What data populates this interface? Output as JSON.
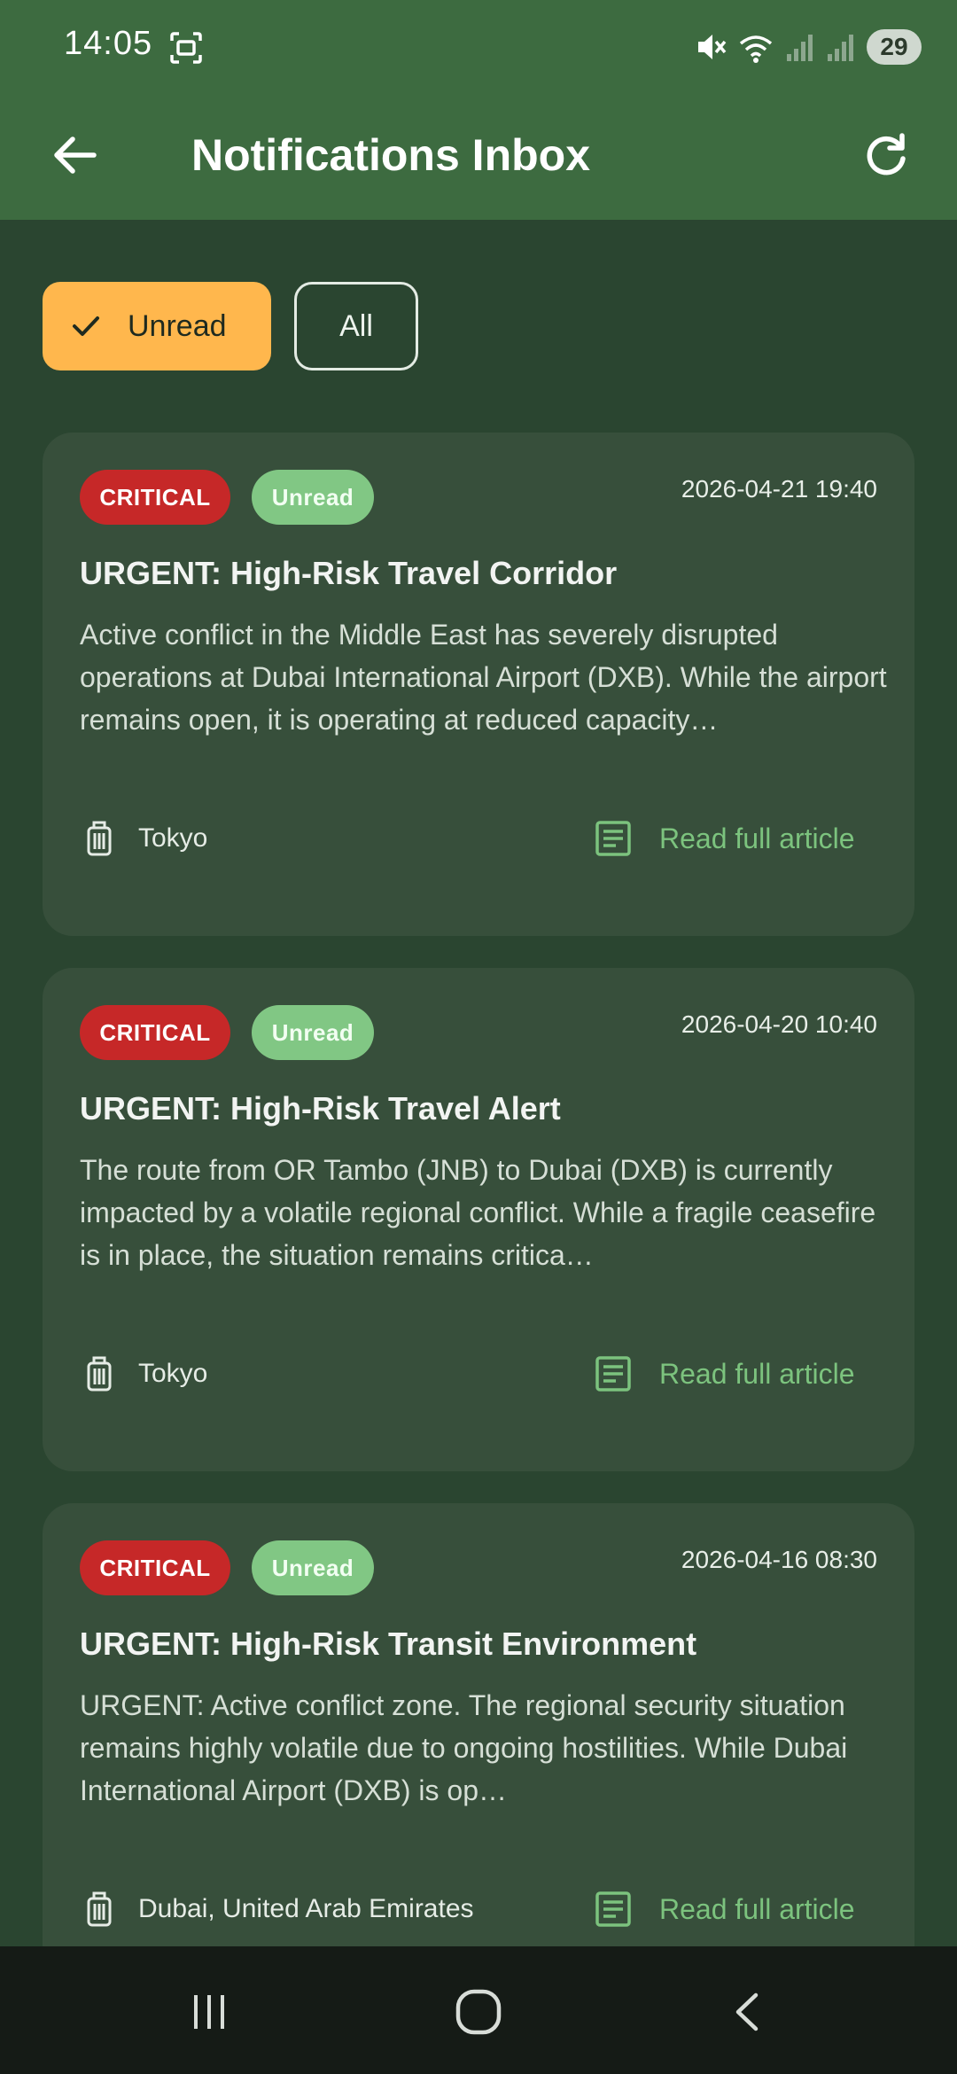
{
  "status_bar": {
    "time": "14:05",
    "battery": "29"
  },
  "header": {
    "title": "Notifications Inbox"
  },
  "filters": {
    "unread_label": "Unread",
    "all_label": "All"
  },
  "notifications": [
    {
      "severity": "CRITICAL",
      "status": "Unread",
      "date": "2026-04-21 19:40",
      "title": "URGENT: High-Risk Travel Corridor",
      "body": "Active conflict in the Middle East has severely disrupted operations at Dubai International Airport (DXB). While the airport remains open, it is operating at reduced capacity…",
      "location": "Tokyo",
      "link_label": "Read full article"
    },
    {
      "severity": "CRITICAL",
      "status": "Unread",
      "date": "2026-04-20 10:40",
      "title": "URGENT: High-Risk Travel Alert",
      "body": "The route from OR Tambo (JNB) to Dubai (DXB) is currently impacted by a volatile regional conflict. While a fragile ceasefire is in place, the situation remains critica…",
      "location": "Tokyo",
      "link_label": "Read full article"
    },
    {
      "severity": "CRITICAL",
      "status": "Unread",
      "date": "2026-04-16 08:30",
      "title": "URGENT: High-Risk Transit Environment",
      "body": "URGENT: Active conflict zone. The regional security situation remains highly volatile due to ongoing hostilities. While Dubai International Airport (DXB) is op…",
      "location": "Dubai, United Arab Emirates",
      "link_label": "Read full article"
    }
  ],
  "icons": {
    "back": "arrow-left-icon",
    "refresh": "refresh-icon",
    "check": "check-icon",
    "luggage": "luggage-icon",
    "article": "article-icon"
  },
  "colors": {
    "appbar": "#3d6b40",
    "background": "#2a4530",
    "card": "#374f3b",
    "critical": "#c62828",
    "unread_badge": "#81c784",
    "chip_selected": "#ffb74d",
    "link": "#7cc37e"
  }
}
